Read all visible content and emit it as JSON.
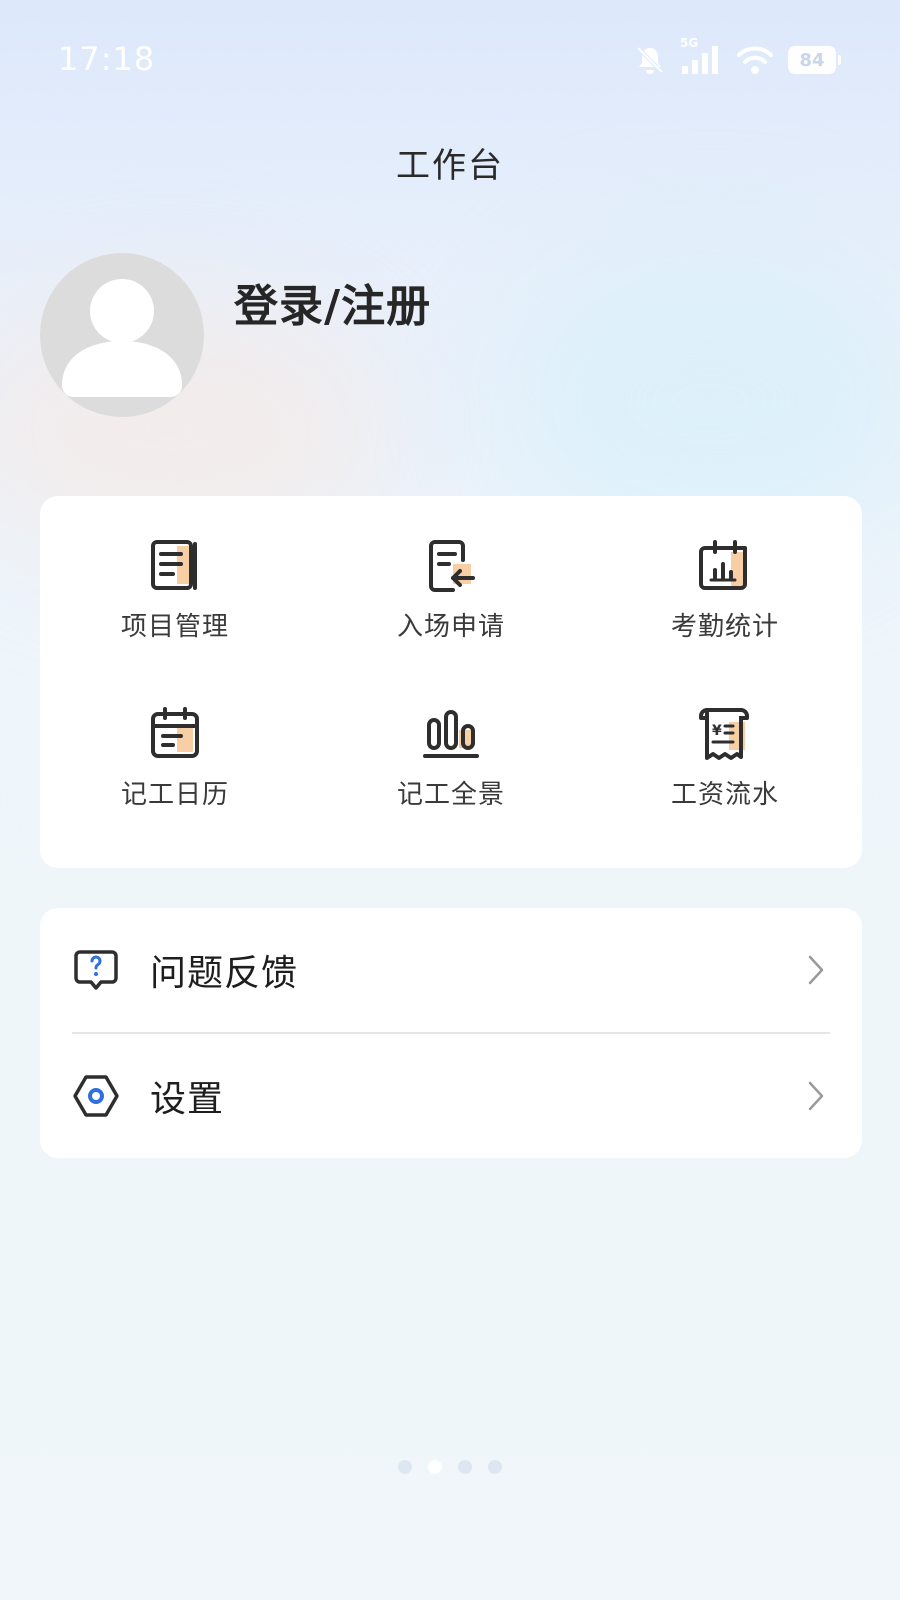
{
  "status_bar": {
    "time": "17:18",
    "network": "5G",
    "battery": "84"
  },
  "header": {
    "title": "工作台"
  },
  "profile": {
    "login_label": "登录/注册"
  },
  "tools": [
    {
      "label": "项目管理",
      "icon": "project-management-icon"
    },
    {
      "label": "入场申请",
      "icon": "entry-application-icon"
    },
    {
      "label": "考勤统计",
      "icon": "attendance-stats-icon"
    },
    {
      "label": "记工日历",
      "icon": "work-calendar-icon"
    },
    {
      "label": "记工全景",
      "icon": "work-overview-icon"
    },
    {
      "label": "工资流水",
      "icon": "salary-record-icon"
    }
  ],
  "menu": [
    {
      "label": "问题反馈",
      "icon": "feedback-icon"
    },
    {
      "label": "设置",
      "icon": "settings-icon"
    }
  ],
  "page_indicator": {
    "count": 4,
    "active": 2
  },
  "colors": {
    "accent": "#f5b57a",
    "icon_stroke": "#2e2e2e",
    "settings_blue": "#2f6fe0",
    "feedback_blue": "#2f6fe0"
  }
}
